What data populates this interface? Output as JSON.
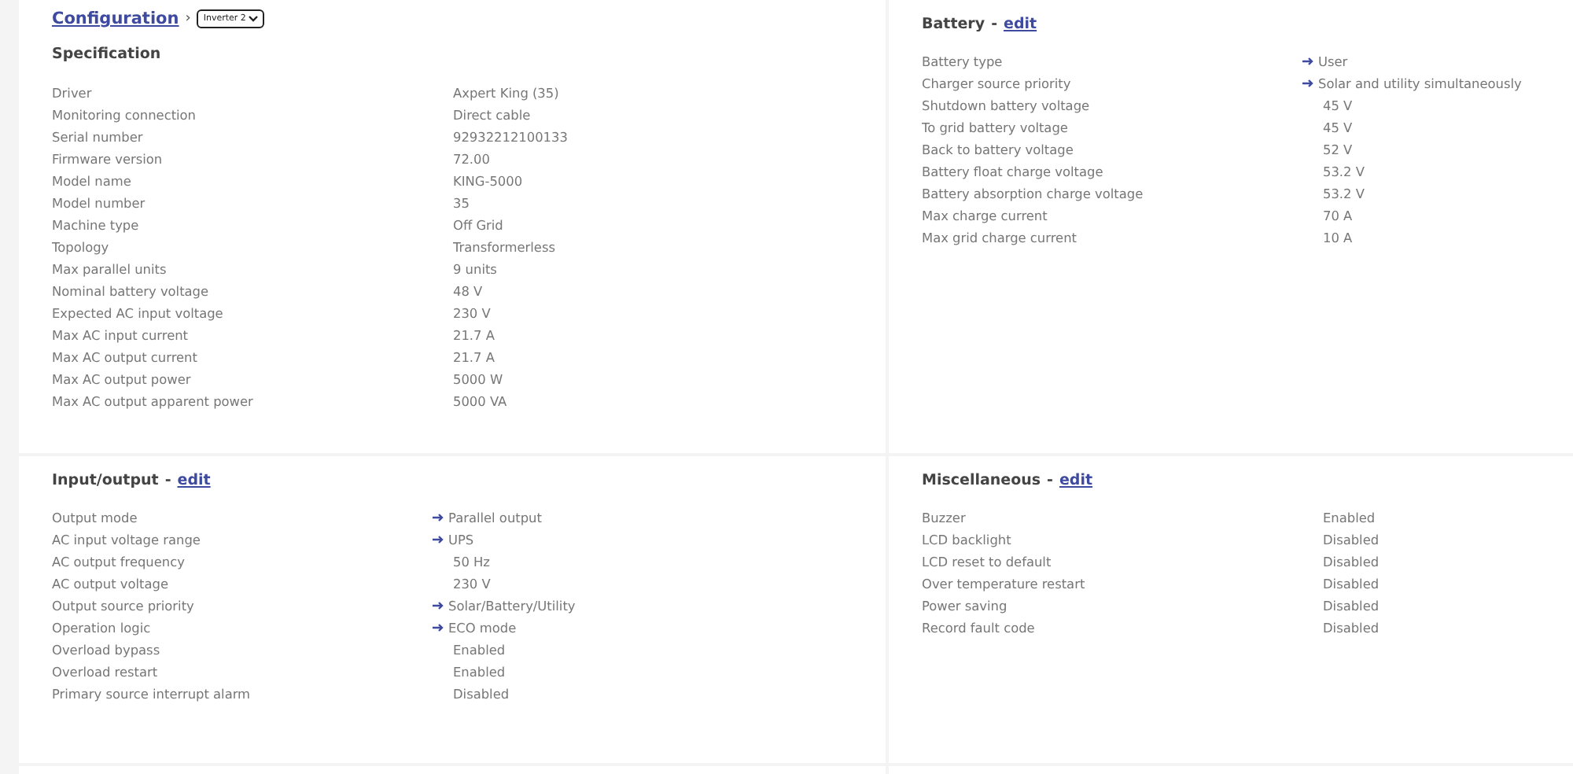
{
  "panels": [
    {
      "breadcrumb": {
        "link": "Configuration",
        "separator": "›",
        "select": {
          "value": "Inverter 2"
        }
      },
      "title": "Specification",
      "rows": [
        {
          "label": "Driver",
          "value": "Axpert King (35)",
          "linked": false
        },
        {
          "label": "Monitoring connection",
          "value": "Direct cable",
          "linked": false
        },
        {
          "label": "Serial number",
          "value": "92932212100133",
          "linked": false
        },
        {
          "label": "Firmware version",
          "value": "72.00",
          "linked": false
        },
        {
          "label": "Model name",
          "value": "KING-5000",
          "linked": false
        },
        {
          "label": "Model number",
          "value": "35",
          "linked": false
        },
        {
          "label": "Machine type",
          "value": "Off Grid",
          "linked": false
        },
        {
          "label": "Topology",
          "value": "Transformerless",
          "linked": false
        },
        {
          "label": "Max parallel units",
          "value": "9 units",
          "linked": false
        },
        {
          "label": "Nominal battery voltage",
          "value": "48 V",
          "linked": false
        },
        {
          "label": "Expected AC input voltage",
          "value": "230 V",
          "linked": false
        },
        {
          "label": "Max AC input current",
          "value": "21.7 A",
          "linked": false
        },
        {
          "label": "Max AC output current",
          "value": "21.7 A",
          "linked": false
        },
        {
          "label": "Max AC output power",
          "value": "5000 W",
          "linked": false
        },
        {
          "label": "Max AC output apparent power",
          "value": "5000 VA",
          "linked": false
        }
      ]
    },
    {
      "title": "Battery",
      "separator": "-",
      "edit_link": "edit",
      "rows": [
        {
          "label": "Battery type",
          "value": "User",
          "linked": true
        },
        {
          "label": "Charger source priority",
          "value": "Solar and utility simultaneously",
          "linked": true
        },
        {
          "label": "Shutdown battery voltage",
          "value": "45 V",
          "linked": false
        },
        {
          "label": "To grid battery voltage",
          "value": "45 V",
          "linked": false
        },
        {
          "label": "Back to battery voltage",
          "value": "52 V",
          "linked": false
        },
        {
          "label": "Battery float charge voltage",
          "value": "53.2 V",
          "linked": false
        },
        {
          "label": "Battery absorption charge voltage",
          "value": "53.2 V",
          "linked": false
        },
        {
          "label": "Max charge current",
          "value": "70 A",
          "linked": false
        },
        {
          "label": "Max grid charge current",
          "value": "10 A",
          "linked": false
        }
      ]
    },
    {
      "title": "Input/output",
      "separator": "-",
      "edit_link": "edit",
      "rows": [
        {
          "label": "Output mode",
          "value": "Parallel output",
          "linked": true
        },
        {
          "label": "AC input voltage range",
          "value": "UPS",
          "linked": true
        },
        {
          "label": "AC output frequency",
          "value": "50 Hz",
          "linked": false
        },
        {
          "label": "AC output voltage",
          "value": "230 V",
          "linked": false
        },
        {
          "label": "Output source priority",
          "value": "Solar/Battery/Utility",
          "linked": true
        },
        {
          "label": "Operation logic",
          "value": "ECO mode",
          "linked": true
        },
        {
          "label": "Overload bypass",
          "value": "Enabled",
          "linked": false
        },
        {
          "label": "Overload restart",
          "value": "Enabled",
          "linked": false
        },
        {
          "label": "Primary source interrupt alarm",
          "value": "Disabled",
          "linked": false
        }
      ]
    },
    {
      "title": "Miscellaneous",
      "separator": "-",
      "edit_link": "edit",
      "rows": [
        {
          "label": "Buzzer",
          "value": "Enabled",
          "linked": false
        },
        {
          "label": "LCD backlight",
          "value": "Disabled",
          "linked": false
        },
        {
          "label": "LCD reset to default",
          "value": "Disabled",
          "linked": false
        },
        {
          "label": "Over temperature restart",
          "value": "Disabled",
          "linked": false
        },
        {
          "label": "Power saving",
          "value": "Disabled",
          "linked": false
        },
        {
          "label": "Record fault code",
          "value": "Disabled",
          "linked": false
        }
      ]
    }
  ]
}
